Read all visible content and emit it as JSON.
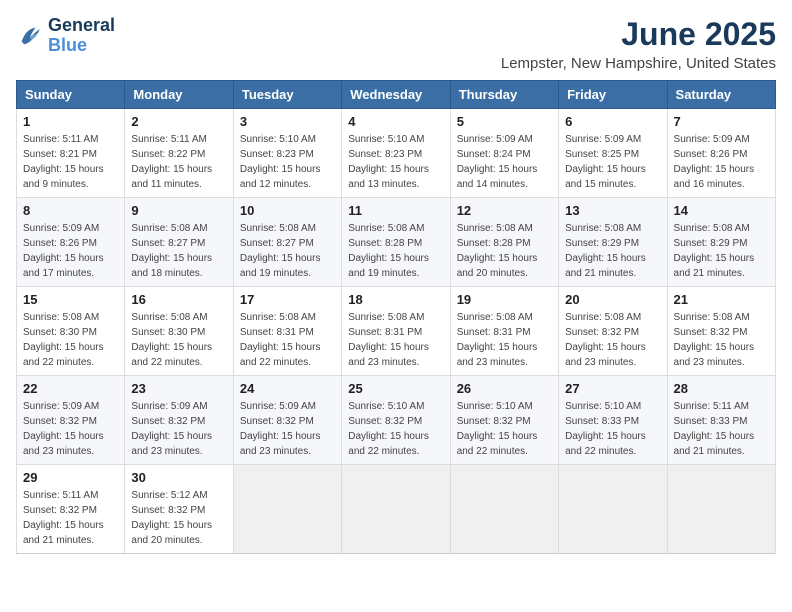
{
  "logo": {
    "line1": "General",
    "line2": "Blue"
  },
  "title": "June 2025",
  "location": "Lempster, New Hampshire, United States",
  "headers": [
    "Sunday",
    "Monday",
    "Tuesday",
    "Wednesday",
    "Thursday",
    "Friday",
    "Saturday"
  ],
  "weeks": [
    [
      {
        "day": "1",
        "sunrise": "5:11 AM",
        "sunset": "8:21 PM",
        "daylight": "15 hours and 9 minutes."
      },
      {
        "day": "2",
        "sunrise": "5:11 AM",
        "sunset": "8:22 PM",
        "daylight": "15 hours and 11 minutes."
      },
      {
        "day": "3",
        "sunrise": "5:10 AM",
        "sunset": "8:23 PM",
        "daylight": "15 hours and 12 minutes."
      },
      {
        "day": "4",
        "sunrise": "5:10 AM",
        "sunset": "8:23 PM",
        "daylight": "15 hours and 13 minutes."
      },
      {
        "day": "5",
        "sunrise": "5:09 AM",
        "sunset": "8:24 PM",
        "daylight": "15 hours and 14 minutes."
      },
      {
        "day": "6",
        "sunrise": "5:09 AM",
        "sunset": "8:25 PM",
        "daylight": "15 hours and 15 minutes."
      },
      {
        "day": "7",
        "sunrise": "5:09 AM",
        "sunset": "8:26 PM",
        "daylight": "15 hours and 16 minutes."
      }
    ],
    [
      {
        "day": "8",
        "sunrise": "5:09 AM",
        "sunset": "8:26 PM",
        "daylight": "15 hours and 17 minutes."
      },
      {
        "day": "9",
        "sunrise": "5:08 AM",
        "sunset": "8:27 PM",
        "daylight": "15 hours and 18 minutes."
      },
      {
        "day": "10",
        "sunrise": "5:08 AM",
        "sunset": "8:27 PM",
        "daylight": "15 hours and 19 minutes."
      },
      {
        "day": "11",
        "sunrise": "5:08 AM",
        "sunset": "8:28 PM",
        "daylight": "15 hours and 19 minutes."
      },
      {
        "day": "12",
        "sunrise": "5:08 AM",
        "sunset": "8:28 PM",
        "daylight": "15 hours and 20 minutes."
      },
      {
        "day": "13",
        "sunrise": "5:08 AM",
        "sunset": "8:29 PM",
        "daylight": "15 hours and 21 minutes."
      },
      {
        "day": "14",
        "sunrise": "5:08 AM",
        "sunset": "8:29 PM",
        "daylight": "15 hours and 21 minutes."
      }
    ],
    [
      {
        "day": "15",
        "sunrise": "5:08 AM",
        "sunset": "8:30 PM",
        "daylight": "15 hours and 22 minutes."
      },
      {
        "day": "16",
        "sunrise": "5:08 AM",
        "sunset": "8:30 PM",
        "daylight": "15 hours and 22 minutes."
      },
      {
        "day": "17",
        "sunrise": "5:08 AM",
        "sunset": "8:31 PM",
        "daylight": "15 hours and 22 minutes."
      },
      {
        "day": "18",
        "sunrise": "5:08 AM",
        "sunset": "8:31 PM",
        "daylight": "15 hours and 23 minutes."
      },
      {
        "day": "19",
        "sunrise": "5:08 AM",
        "sunset": "8:31 PM",
        "daylight": "15 hours and 23 minutes."
      },
      {
        "day": "20",
        "sunrise": "5:08 AM",
        "sunset": "8:32 PM",
        "daylight": "15 hours and 23 minutes."
      },
      {
        "day": "21",
        "sunrise": "5:08 AM",
        "sunset": "8:32 PM",
        "daylight": "15 hours and 23 minutes."
      }
    ],
    [
      {
        "day": "22",
        "sunrise": "5:09 AM",
        "sunset": "8:32 PM",
        "daylight": "15 hours and 23 minutes."
      },
      {
        "day": "23",
        "sunrise": "5:09 AM",
        "sunset": "8:32 PM",
        "daylight": "15 hours and 23 minutes."
      },
      {
        "day": "24",
        "sunrise": "5:09 AM",
        "sunset": "8:32 PM",
        "daylight": "15 hours and 23 minutes."
      },
      {
        "day": "25",
        "sunrise": "5:10 AM",
        "sunset": "8:32 PM",
        "daylight": "15 hours and 22 minutes."
      },
      {
        "day": "26",
        "sunrise": "5:10 AM",
        "sunset": "8:32 PM",
        "daylight": "15 hours and 22 minutes."
      },
      {
        "day": "27",
        "sunrise": "5:10 AM",
        "sunset": "8:33 PM",
        "daylight": "15 hours and 22 minutes."
      },
      {
        "day": "28",
        "sunrise": "5:11 AM",
        "sunset": "8:33 PM",
        "daylight": "15 hours and 21 minutes."
      }
    ],
    [
      {
        "day": "29",
        "sunrise": "5:11 AM",
        "sunset": "8:32 PM",
        "daylight": "15 hours and 21 minutes."
      },
      {
        "day": "30",
        "sunrise": "5:12 AM",
        "sunset": "8:32 PM",
        "daylight": "15 hours and 20 minutes."
      },
      null,
      null,
      null,
      null,
      null
    ]
  ]
}
